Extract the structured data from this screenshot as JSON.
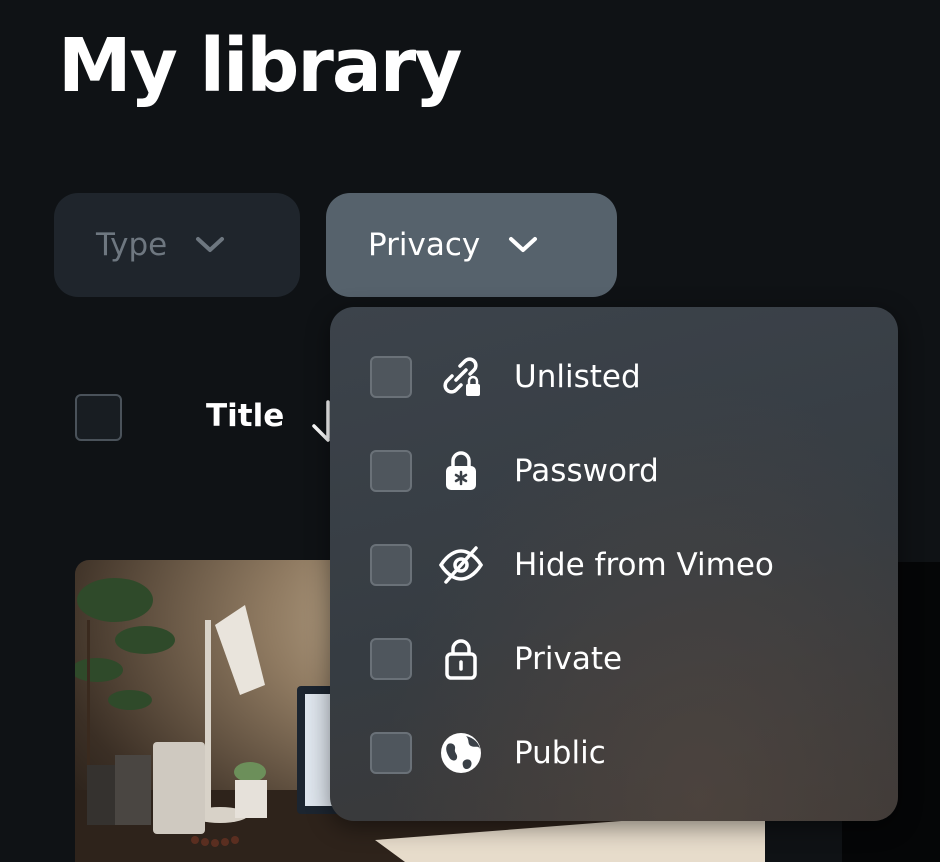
{
  "page": {
    "title": "My library"
  },
  "filters": {
    "type": {
      "label": "Type",
      "icon": "chevron-down-icon"
    },
    "privacy": {
      "label": "Privacy",
      "icon": "chevron-down-icon"
    }
  },
  "table": {
    "title_column": "Title",
    "sort_icon": "sort-down-arrow-icon"
  },
  "privacy_menu": {
    "items": [
      {
        "label": "Unlisted",
        "icon": "link-lock-icon",
        "checked": false
      },
      {
        "label": "Password",
        "icon": "password-lock-icon",
        "checked": false
      },
      {
        "label": "Hide from Vimeo",
        "icon": "eye-off-icon",
        "checked": false
      },
      {
        "label": "Private",
        "icon": "lock-icon",
        "checked": false
      },
      {
        "label": "Public",
        "icon": "globe-icon",
        "checked": false
      }
    ]
  },
  "colors": {
    "background": "#0f1215",
    "type_button_bg": "#1f252c",
    "privacy_button_bg": "#56626c",
    "menu_bg": "#3a4047"
  }
}
